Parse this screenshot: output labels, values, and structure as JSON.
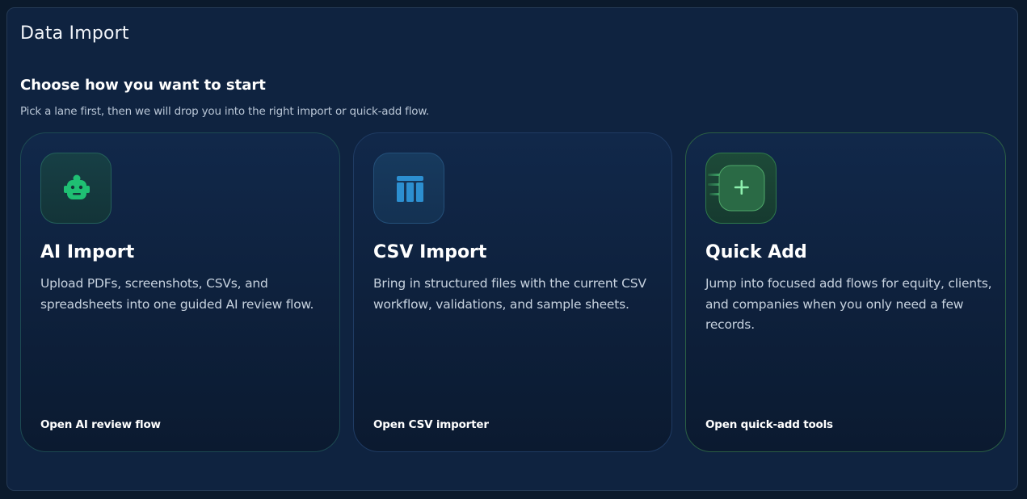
{
  "panel": {
    "title": "Data Import"
  },
  "section": {
    "title": "Choose how you want to start",
    "subtitle": "Pick a lane first, then we will drop you into the right import or quick-add flow."
  },
  "cards": [
    {
      "icon": "robot-icon",
      "title": "AI Import",
      "description": "Upload PDFs, screenshots, CSVs, and spreadsheets into one guided AI review flow.",
      "link": "Open AI review flow",
      "accent": "#1fbf73"
    },
    {
      "icon": "table-columns-icon",
      "title": "CSV Import",
      "description": "Bring in structured files with the current CSV workflow, validations, and sample sheets.",
      "link": "Open CSV importer",
      "accent": "#2c8fd0"
    },
    {
      "icon": "quick-add-plus-icon",
      "title": "Quick Add",
      "description": "Jump into focused add flows for equity, clients, and companies when you only need a few records.",
      "link": "Open quick-add tools",
      "accent": "#4fd37f"
    }
  ],
  "colors": {
    "background": "#0b1a2c",
    "panel": "#0f2340",
    "text_primary": "#ffffff",
    "text_secondary": "#c7d2df"
  }
}
